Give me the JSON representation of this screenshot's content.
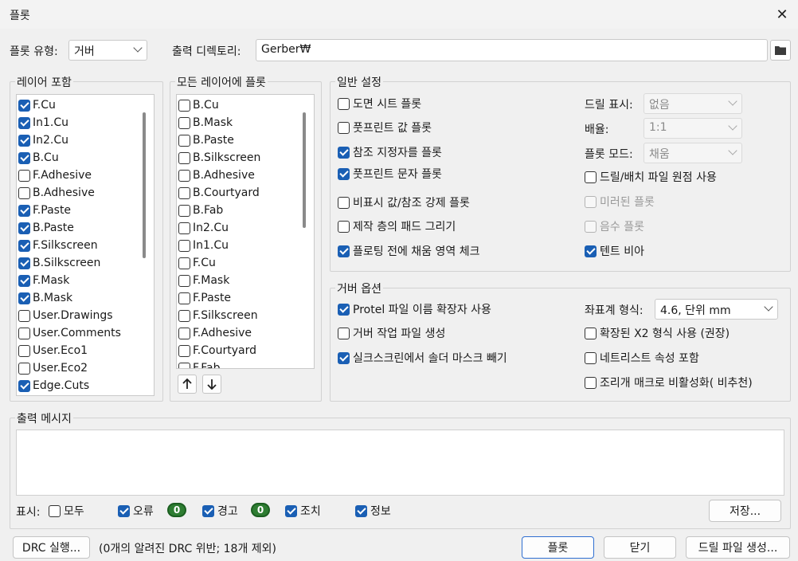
{
  "window": {
    "title": "플롯",
    "close_icon": "close-icon"
  },
  "top": {
    "plot_format_label": "플롯 유형:",
    "plot_format_value": "거버",
    "output_dir_label": "출력 디렉토리:",
    "output_dir_value": "Gerber₩",
    "folder_icon": "folder-icon"
  },
  "include_layers": {
    "title": "레이어 포함",
    "items": [
      {
        "label": "F.Cu",
        "checked": true
      },
      {
        "label": "In1.Cu",
        "checked": true
      },
      {
        "label": "In2.Cu",
        "checked": true
      },
      {
        "label": "B.Cu",
        "checked": true
      },
      {
        "label": "F.Adhesive",
        "checked": false
      },
      {
        "label": "B.Adhesive",
        "checked": false
      },
      {
        "label": "F.Paste",
        "checked": true
      },
      {
        "label": "B.Paste",
        "checked": true
      },
      {
        "label": "F.Silkscreen",
        "checked": true
      },
      {
        "label": "B.Silkscreen",
        "checked": true
      },
      {
        "label": "F.Mask",
        "checked": true
      },
      {
        "label": "B.Mask",
        "checked": true
      },
      {
        "label": "User.Drawings",
        "checked": false
      },
      {
        "label": "User.Comments",
        "checked": false
      },
      {
        "label": "User.Eco1",
        "checked": false
      },
      {
        "label": "User.Eco2",
        "checked": false
      },
      {
        "label": "Edge.Cuts",
        "checked": true
      }
    ]
  },
  "plot_all_layers": {
    "title": "모든 레이어에 플롯",
    "items": [
      {
        "label": "B.Cu",
        "checked": false
      },
      {
        "label": "B.Mask",
        "checked": false
      },
      {
        "label": "B.Paste",
        "checked": false
      },
      {
        "label": "B.Silkscreen",
        "checked": false
      },
      {
        "label": "B.Adhesive",
        "checked": false
      },
      {
        "label": "B.Courtyard",
        "checked": false
      },
      {
        "label": "B.Fab",
        "checked": false
      },
      {
        "label": "In2.Cu",
        "checked": false
      },
      {
        "label": "In1.Cu",
        "checked": false
      },
      {
        "label": "F.Cu",
        "checked": false
      },
      {
        "label": "F.Mask",
        "checked": false
      },
      {
        "label": "F.Paste",
        "checked": false
      },
      {
        "label": "F.Silkscreen",
        "checked": false
      },
      {
        "label": "F.Adhesive",
        "checked": false
      },
      {
        "label": "F.Courtyard",
        "checked": false
      },
      {
        "label": "F.Fab",
        "checked": false
      }
    ],
    "move_up_icon": "arrow-up-icon",
    "move_down_icon": "arrow-down-icon"
  },
  "general": {
    "title": "일반 설정",
    "left_options": [
      {
        "label": "도면 시트 플롯",
        "checked": false
      },
      {
        "label": "풋프린트 값 플롯",
        "checked": false
      },
      {
        "label": "참조 지정자를 플롯",
        "checked": true
      },
      {
        "label": "풋프린트 문자 플롯",
        "checked": true
      },
      {
        "label": "비표시 값/참조 강제 플롯",
        "checked": false
      },
      {
        "label": "제작 층의 패드 그리기",
        "checked": false
      },
      {
        "label": "플로팅 전에 채움 영역 체크",
        "checked": true
      }
    ],
    "drill_marks_label": "드릴 표시:",
    "drill_marks_value": "없음",
    "scale_label": "배율:",
    "scale_value": "1:1",
    "plot_mode_label": "플롯 모드:",
    "plot_mode_value": "채움",
    "right_options": [
      {
        "label": "드릴/배치 파일 원점 사용",
        "checked": false,
        "disabled": false
      },
      {
        "label": "미러된 플롯",
        "checked": false,
        "disabled": true
      },
      {
        "label": "음수 플롯",
        "checked": false,
        "disabled": true
      },
      {
        "label": "텐트 비아",
        "checked": true,
        "disabled": false
      }
    ]
  },
  "gerber": {
    "title": "거버 옵션",
    "left_options": [
      {
        "label": "Protel 파일 이름 확장자 사용",
        "checked": true
      },
      {
        "label": "거버 작업 파일 생성",
        "checked": false
      },
      {
        "label": "실크스크린에서 솔더 마스크 빼기",
        "checked": true
      }
    ],
    "coord_label": "좌표계 형식:",
    "coord_value": "4.6, 단위 mm",
    "right_options": [
      {
        "label": "확장된 X2 형식 사용 (권장)",
        "checked": false
      },
      {
        "label": "네트리스트 속성 포함",
        "checked": false
      },
      {
        "label": "조리개 매크로 비활성화( 비추천)",
        "checked": false
      }
    ]
  },
  "messages": {
    "title": "출력 메시지",
    "show_label": "표시:",
    "all_label": "모두",
    "all_checked": false,
    "errors_label": "오류",
    "errors_checked": true,
    "errors_count": "0",
    "warnings_label": "경고",
    "warnings_checked": true,
    "warnings_count": "0",
    "actions_label": "조치",
    "actions_checked": true,
    "info_label": "정보",
    "info_checked": true,
    "save_label": "저장..."
  },
  "bottom": {
    "drc_button": "DRC 실행...",
    "drc_status": "(0개의 알려진 DRC 위반; 18개 제외)",
    "plot_button": "플롯",
    "close_button": "닫기",
    "drill_button": "드릴 파일 생성..."
  }
}
